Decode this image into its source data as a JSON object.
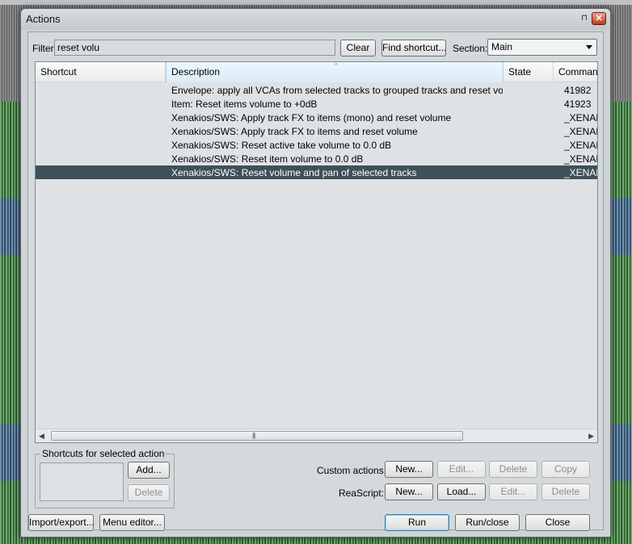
{
  "window": {
    "title": "Actions",
    "pin_glyph": "⊓",
    "close_glyph": "✕"
  },
  "filter": {
    "label": "Filter:",
    "value": "reset volu",
    "clear_label": "Clear",
    "find_shortcut_label": "Find shortcut...",
    "section_label": "Section:",
    "section_value": "Main"
  },
  "table": {
    "columns": [
      "Shortcut",
      "Description",
      "State",
      "Command"
    ],
    "sort_indicator": "^",
    "rows": [
      {
        "shortcut": "",
        "description": "Envelope: apply all VCAs from selected tracks to grouped tracks and reset volume/p...",
        "state": "",
        "command": "41982"
      },
      {
        "shortcut": "",
        "description": "Item: Reset items volume to +0dB",
        "state": "",
        "command": "41923"
      },
      {
        "shortcut": "",
        "description": "Xenakios/SWS: Apply track FX to items (mono) and reset volume",
        "state": "",
        "command": "_XENAK"
      },
      {
        "shortcut": "",
        "description": "Xenakios/SWS: Apply track FX to items and reset volume",
        "state": "",
        "command": "_XENAK"
      },
      {
        "shortcut": "",
        "description": "Xenakios/SWS: Reset active take volume to 0.0 dB",
        "state": "",
        "command": "_XENAK"
      },
      {
        "shortcut": "",
        "description": "Xenakios/SWS: Reset item volume to 0.0 dB",
        "state": "",
        "command": "_XENAK"
      },
      {
        "shortcut": "",
        "description": "Xenakios/SWS: Reset volume and pan of selected tracks",
        "state": "",
        "command": "_XENAK"
      }
    ],
    "selected_row": 6,
    "scroll_left": "◀",
    "scroll_right": "▶",
    "scroll_grip": "|||"
  },
  "shortcuts_group": {
    "title": "Shortcuts for selected action",
    "add_label": "Add...",
    "delete_label": "Delete"
  },
  "custom_actions": {
    "label": "Custom actions:",
    "new_label": "New...",
    "edit_label": "Edit...",
    "delete_label": "Delete",
    "copy_label": "Copy"
  },
  "reascript": {
    "label": "ReaScript:",
    "new_label": "New...",
    "load_label": "Load...",
    "edit_label": "Edit...",
    "delete_label": "Delete"
  },
  "footer": {
    "import_export_label": "Import/export...",
    "menu_editor_label": "Menu editor...",
    "run_label": "Run",
    "run_close_label": "Run/close",
    "close_label": "Close"
  }
}
